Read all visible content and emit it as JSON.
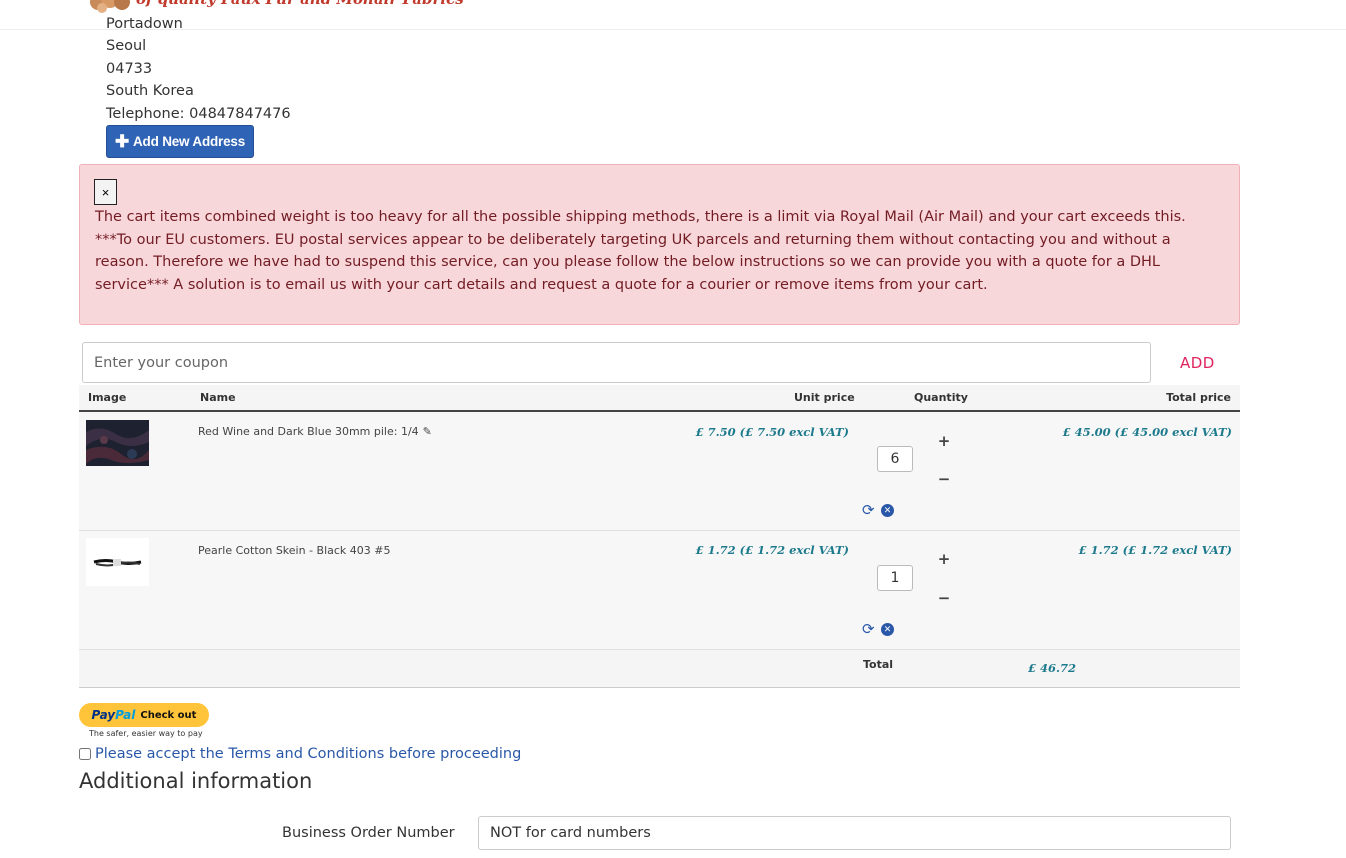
{
  "header": {
    "logo_text": "of quality Faux Fur and Mohair Fabrics"
  },
  "address": {
    "city_partial": "Portadown",
    "city": "Seoul",
    "postcode": "04733",
    "country": "South Korea",
    "telephone": "Telephone: 04847847476",
    "add_button_label": "Add New Address"
  },
  "alert": {
    "close_label": "×",
    "message": "The cart items combined weight is too heavy for all the possible shipping methods, there is a limit via Royal Mail (Air Mail) and your cart exceeds this. ***To our EU customers. EU postal services appear to be deliberately targeting UK parcels and returning them without contacting you and without a reason. Therefore we have had to suspend this service, can you please follow the below instructions so we can provide you with a quote for a DHL service*** A solution is to email us with your cart details and request a quote for a courier or remove items from your cart."
  },
  "coupon": {
    "placeholder": "Enter your coupon",
    "add_label": "ADD"
  },
  "cart": {
    "headers": {
      "image": "Image",
      "name": "Name",
      "unit_price": "Unit price",
      "quantity": "Quantity",
      "total_price": "Total price"
    },
    "items": [
      {
        "name": "Red Wine and Dark Blue 30mm pile: 1/4",
        "unit_price": "£ 7.50 (£ 7.50 excl VAT)",
        "quantity": "6",
        "total_price": "£ 45.00 (£ 45.00 excl VAT)",
        "image_icon": "fur-swatch-icon"
      },
      {
        "name": "Pearle Cotton Skein - Black 403 #5",
        "unit_price": "£ 1.72 (£ 1.72 excl VAT)",
        "quantity": "1",
        "total_price": "£ 1.72 (£ 1.72 excl VAT)",
        "image_icon": "thread-skein-icon"
      }
    ],
    "plus_label": "+",
    "minus_label": "−",
    "total_label": "Total",
    "total_value": "£ 46.72"
  },
  "paypal": {
    "pay": "Pay",
    "pal": "Pal",
    "checkout": "Check out",
    "tagline": "The safer, easier way to pay"
  },
  "terms": {
    "label": "Please accept the Terms and Conditions before proceeding"
  },
  "additional": {
    "title": "Additional information",
    "business_order_label": "Business Order Number",
    "business_order_placeholder": "NOT for card numbers"
  },
  "colors": {
    "primary_button": "#2f63b5",
    "alert_bg": "#f8d7da",
    "alert_text": "#721c24",
    "price_text": "#1d7a8c",
    "coupon_add": "#e0245e",
    "paypal_yellow": "#ffc439"
  }
}
